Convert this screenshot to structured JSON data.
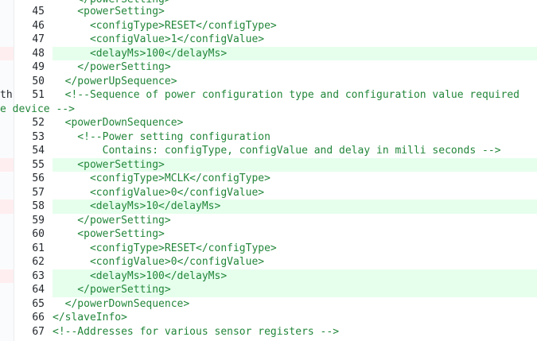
{
  "lines": [
    {
      "num": "45",
      "text": "    <powerSetting>",
      "type": "tag"
    },
    {
      "num": "46",
      "text": "      <configType>RESET</configType>",
      "type": "tag"
    },
    {
      "num": "47",
      "text": "      <configValue>1</configValue>",
      "type": "tag"
    },
    {
      "num": "48",
      "text": "      <delayMs>100</delayMs>",
      "type": "tag",
      "added": true
    },
    {
      "num": "49",
      "text": "    </powerSetting>",
      "type": "tag"
    },
    {
      "num": "50",
      "text": "  </powerUpSequence>",
      "type": "tag"
    },
    {
      "num": "51",
      "text": "  <!--Sequence of power configuration type and configuration value required",
      "type": "comment"
    },
    {
      "num": "52",
      "text": "  <powerDownSequence>",
      "type": "tag"
    },
    {
      "num": "53",
      "text": "    <!--Power setting configuration",
      "type": "comment"
    },
    {
      "num": "54",
      "text": "        Contains: configType, configValue and delay in milli seconds -->",
      "type": "comment"
    },
    {
      "num": "55",
      "text": "    <powerSetting>",
      "type": "tag",
      "added": true
    },
    {
      "num": "56",
      "text": "      <configType>MCLK</configType>",
      "type": "tag"
    },
    {
      "num": "57",
      "text": "      <configValue>0</configValue>",
      "type": "tag"
    },
    {
      "num": "58",
      "text": "      <delayMs>10</delayMs>",
      "type": "tag",
      "added": true
    },
    {
      "num": "59",
      "text": "    </powerSetting>",
      "type": "tag"
    },
    {
      "num": "60",
      "text": "    <powerSetting>",
      "type": "tag"
    },
    {
      "num": "61",
      "text": "      <configType>RESET</configType>",
      "type": "tag"
    },
    {
      "num": "62",
      "text": "      <configValue>0</configValue>",
      "type": "tag"
    },
    {
      "num": "63",
      "text": "      <delayMs>100</delayMs>",
      "type": "tag",
      "added": true
    },
    {
      "num": "64",
      "text": "    </powerSetting>",
      "type": "tag",
      "added": true
    },
    {
      "num": "65",
      "text": "  </powerDownSequence>",
      "type": "tag"
    },
    {
      "num": "66",
      "text": "</slaveInfo>",
      "type": "tag"
    },
    {
      "num": "67",
      "text": "<!--Addresses for various sensor registers -->",
      "type": "comment"
    }
  ],
  "wrap_line": "e device -->",
  "left_cut_text": "th",
  "top_partial": "    </powerSetting>"
}
